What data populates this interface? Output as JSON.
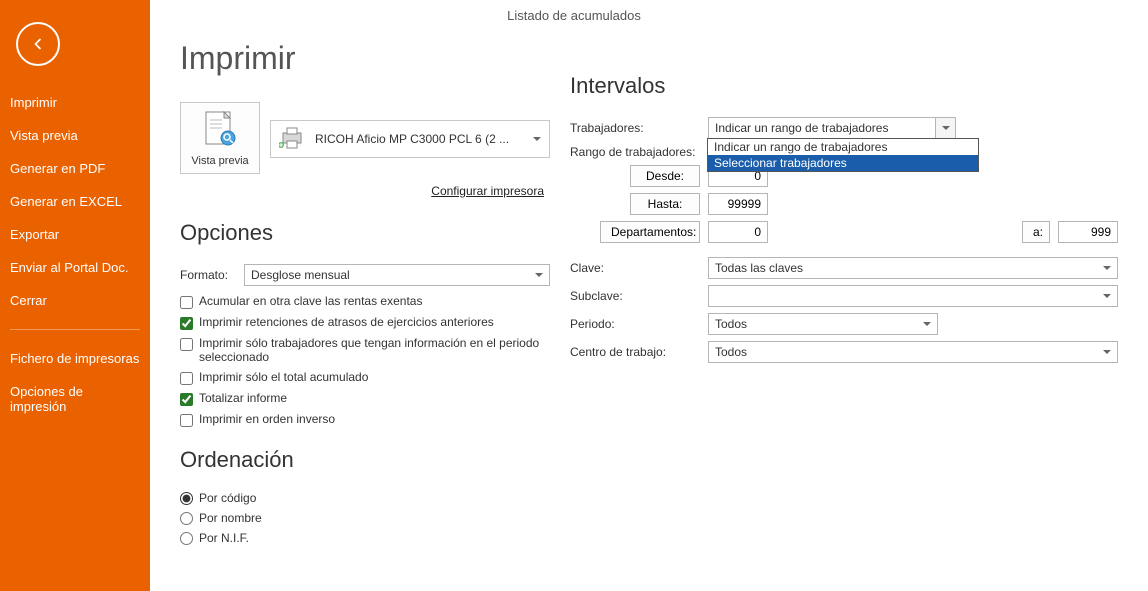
{
  "title": "Listado de acumulados",
  "sidebar": {
    "items": [
      {
        "label": "Imprimir"
      },
      {
        "label": "Vista previa"
      },
      {
        "label": "Generar en PDF"
      },
      {
        "label": "Generar en EXCEL"
      },
      {
        "label": "Exportar"
      },
      {
        "label": "Enviar al Portal Doc."
      },
      {
        "label": "Cerrar"
      }
    ],
    "secondary": [
      {
        "label": "Fichero de impresoras"
      },
      {
        "label": "Opciones de impresión"
      }
    ]
  },
  "main": {
    "heading": "Imprimir",
    "preview_label": "Vista previa",
    "printer_name": "RICOH Aficio MP C3000 PCL 6 (2 ...",
    "configure_link": "Configurar impresora",
    "opciones": {
      "heading": "Opciones",
      "formato_label": "Formato:",
      "formato_value": "Desglose mensual",
      "checks": {
        "acumular": "Acumular en otra clave las rentas exentas",
        "retenciones": "Imprimir retenciones de atrasos de ejercicios anteriores",
        "solo_trab": "Imprimir sólo trabajadores que tengan información en el periodo seleccionado",
        "solo_total": "Imprimir sólo el total acumulado",
        "totalizar": "Totalizar informe",
        "orden_inv": "Imprimir en orden inverso"
      }
    },
    "ordenacion": {
      "heading": "Ordenación",
      "por_codigo": "Por código",
      "por_nombre": "Por nombre",
      "por_nif": "Por N.I.F."
    }
  },
  "intervalos": {
    "heading": "Intervalos",
    "trabajadores_label": "Trabajadores:",
    "trabajadores_value": "Indicar un rango de trabajadores",
    "trabajadores_options": {
      "opt1": "Indicar un rango de trabajadores",
      "opt2": "Seleccionar trabajadores"
    },
    "rango_label": "Rango de trabajadores:",
    "desde_label": "Desde:",
    "desde_value": "0",
    "hasta_label": "Hasta:",
    "hasta_value": "99999",
    "departamentos_label": "Departamentos:",
    "dept_from": "0",
    "a_label": "a:",
    "dept_to": "999",
    "clave_label": "Clave:",
    "clave_value": "Todas las claves",
    "subclave_label": "Subclave:",
    "subclave_value": "",
    "periodo_label": "Periodo:",
    "periodo_value": "Todos",
    "centro_label": "Centro de trabajo:",
    "centro_value": "Todos"
  }
}
